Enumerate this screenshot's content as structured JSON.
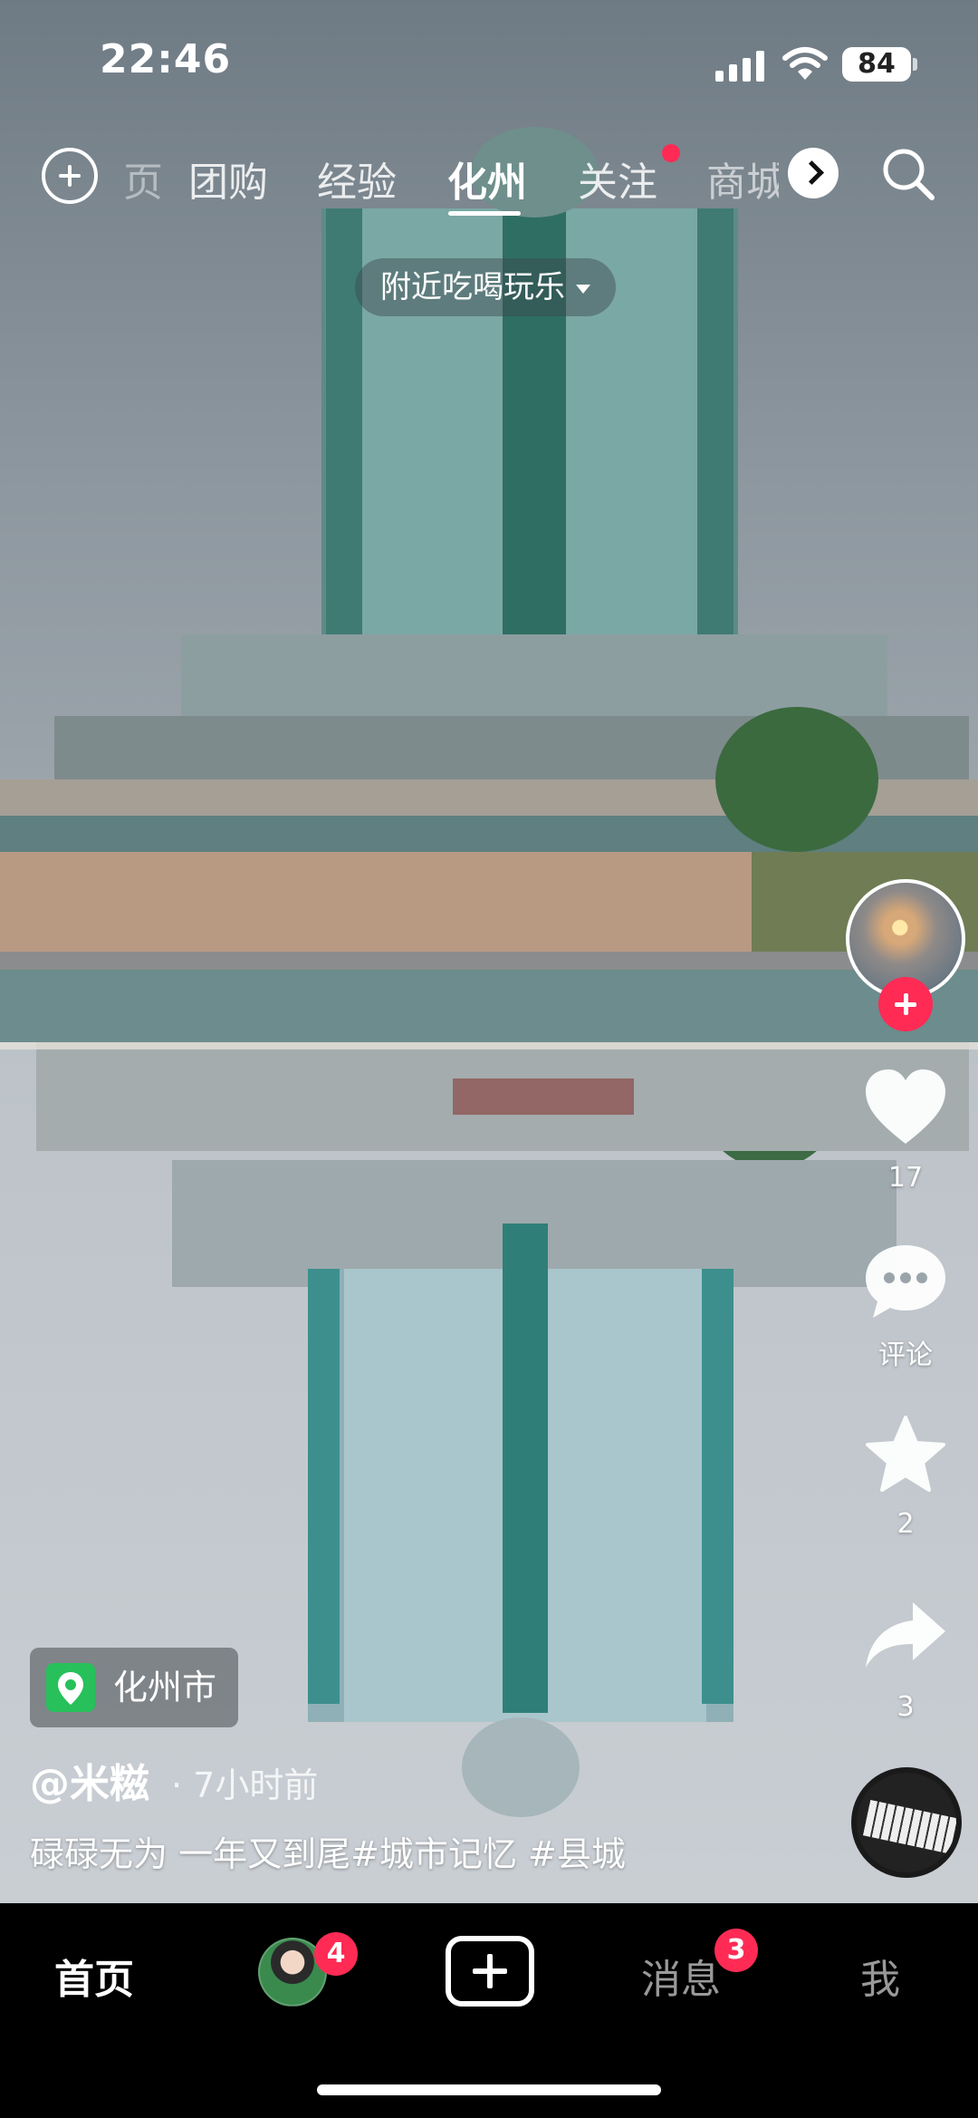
{
  "status_bar": {
    "time": "22:46",
    "battery": "84"
  },
  "top_nav": {
    "tabs": [
      {
        "label": "页"
      },
      {
        "label": "团购"
      },
      {
        "label": "经验"
      },
      {
        "label": "化州"
      },
      {
        "label": "关注"
      },
      {
        "label": "商城"
      }
    ],
    "active_tab": "化州",
    "icons": [
      "add-circle-icon",
      "chevron-right-icon",
      "search-icon"
    ]
  },
  "nearby_filter": {
    "label": "附近吃喝玩乐"
  },
  "right_rail": {
    "likes": "17",
    "comments_label": "评论",
    "favorites": "2",
    "shares": "3"
  },
  "post": {
    "location": "化州市",
    "author": "@米糍",
    "time_ago": "· 7小时前",
    "caption": "碌碌无为  一年又到尾#城市记忆 #县城"
  },
  "bottom_tabs": {
    "home": "首页",
    "friends_badge": "4",
    "messages": "消息",
    "messages_badge": "3",
    "me": "我"
  },
  "colors": {
    "accent": "#ff2b55",
    "location_green": "#27c05a"
  }
}
